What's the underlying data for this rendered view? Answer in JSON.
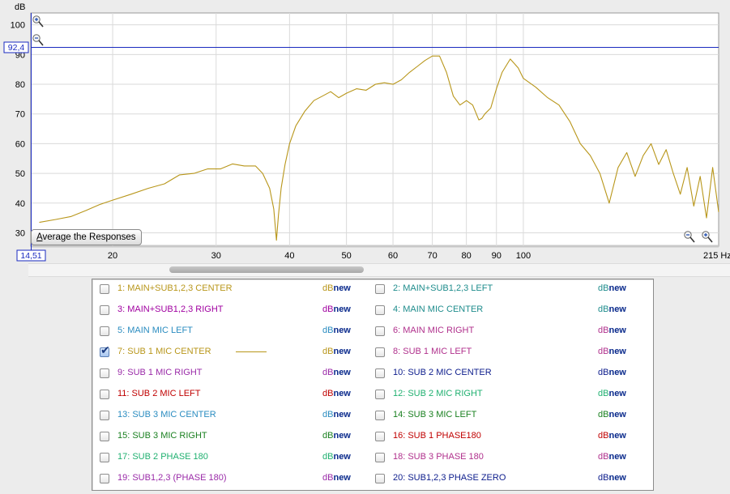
{
  "chart_data": {
    "type": "line",
    "ylabel": "dB",
    "y_ticks": [
      "100",
      "90",
      "80",
      "70",
      "60",
      "50",
      "40",
      "30"
    ],
    "y_tick_values": [
      100,
      90,
      80,
      70,
      60,
      50,
      40,
      30
    ],
    "x_ticks": [
      "20",
      "30",
      "40",
      "50",
      "60",
      "70",
      "80",
      "90",
      "100",
      "215 Hz"
    ],
    "x_tick_values": [
      20,
      30,
      40,
      50,
      60,
      70,
      80,
      90,
      100,
      215
    ],
    "x_scale": "log",
    "xlim": [
      14.51,
      215
    ],
    "ylim": [
      25.5,
      104
    ],
    "cursor_y_label": "92,4",
    "cursor_y_value": 92.4,
    "cursor_x_label": "14,51",
    "grid": true,
    "series": [
      {
        "name": "7: SUB 1 MIC CENTER",
        "color": "#b8961a",
        "x": [
          15,
          16,
          17,
          18,
          19,
          20,
          21.5,
          23,
          24.5,
          26,
          27.5,
          29,
          30.5,
          32,
          33.5,
          35,
          36,
          37,
          37.6,
          38,
          38.3,
          38.7,
          39.3,
          40,
          41,
          42.5,
          44,
          45.5,
          47,
          48.5,
          50,
          52,
          54,
          56,
          58,
          60,
          62,
          64,
          66,
          68,
          70,
          72,
          74,
          76,
          78,
          80,
          82,
          84,
          85,
          86,
          88,
          90,
          92,
          95,
          98,
          100,
          105,
          110,
          115,
          120,
          125,
          130,
          135,
          140,
          145,
          150,
          155,
          160,
          165,
          170,
          175,
          180,
          185,
          190,
          195,
          200,
          205,
          210,
          215
        ],
        "y": [
          33.5,
          34.5,
          35.5,
          37.5,
          39.5,
          41.0,
          43.0,
          45.0,
          46.5,
          49.5,
          50.0,
          51.5,
          51.5,
          53.2,
          52.5,
          52.5,
          50.0,
          45.0,
          38.0,
          27.5,
          36.0,
          45.0,
          53.0,
          60.0,
          66.0,
          71.0,
          74.5,
          76.0,
          77.5,
          75.5,
          77.0,
          78.5,
          78.0,
          80.0,
          80.5,
          80.0,
          81.5,
          84.0,
          86.0,
          88.0,
          89.5,
          89.5,
          84.0,
          76.0,
          73.0,
          74.5,
          73.0,
          68.0,
          68.5,
          70.0,
          72.0,
          78.5,
          84.0,
          88.5,
          85.5,
          82.0,
          79.0,
          75.5,
          73.0,
          67.5,
          60.0,
          56.0,
          50.0,
          40.0,
          52.0,
          57.0,
          49.0,
          56.0,
          60.0,
          53.0,
          58.0,
          50.0,
          43.0,
          52.0,
          39.0,
          49.0,
          35.0,
          52.0,
          37.0
        ]
      }
    ]
  },
  "controls": {
    "average_button_prefix": "A",
    "average_button_rest": "verage the Responses"
  },
  "legend": {
    "dbnew_db": "dB",
    "dbnew_new": "new",
    "items": [
      {
        "label": "1: MAIN+SUB1,2,3 CENTER",
        "color": "#b8961a",
        "checked": false
      },
      {
        "label": "2: MAIN+SUB1,2,3 LEFT",
        "color": "#1e8c8c",
        "checked": false
      },
      {
        "label": "3: MAIN+SUB1,2,3 RIGHT",
        "color": "#a000a0",
        "checked": false
      },
      {
        "label": "4: MAIN MIC CENTER",
        "color": "#1e8c8c",
        "checked": false
      },
      {
        "label": "5: MAIN MIC LEFT",
        "color": "#2a8cc0",
        "checked": false
      },
      {
        "label": "6: MAIN MIC RIGHT",
        "color": "#b0308c",
        "checked": false
      },
      {
        "label": "7: SUB 1 MIC CENTER",
        "color": "#b8961a",
        "checked": true
      },
      {
        "label": "8: SUB 1 MIC LEFT",
        "color": "#b0308c",
        "checked": false
      },
      {
        "label": "9: SUB 1 MIC RIGHT",
        "color": "#9a2aa8",
        "checked": false
      },
      {
        "label": "10: SUB 2 MIC CENTER",
        "color": "#0c1c8c",
        "checked": false
      },
      {
        "label": "11: SUB 2 MIC LEFT",
        "color": "#c00000",
        "checked": false
      },
      {
        "label": "12: SUB 2 MIC RIGHT",
        "color": "#20b070",
        "checked": false
      },
      {
        "label": "13: SUB 3 MIC CENTER",
        "color": "#2a8cc0",
        "checked": false
      },
      {
        "label": "14: SUB 3 MIC LEFT",
        "color": "#1a8020",
        "checked": false
      },
      {
        "label": "15: SUB 3 MIC RIGHT",
        "color": "#1a8020",
        "checked": false
      },
      {
        "label": "16: SUB 1 PHASE180",
        "color": "#c00000",
        "checked": false
      },
      {
        "label": "17: SUB 2 PHASE 180",
        "color": "#20b070",
        "checked": false
      },
      {
        "label": "18: SUB 3 PHASE 180",
        "color": "#b0308c",
        "checked": false
      },
      {
        "label": "19: SUB1,2,3 (PHASE 180)",
        "color": "#9a2aa8",
        "checked": false
      },
      {
        "label": "20: SUB1,2,3 PHASE ZERO",
        "color": "#0c1c8c",
        "checked": false
      }
    ]
  },
  "icons": [
    "zoom-in-icon",
    "zoom-out-icon"
  ]
}
